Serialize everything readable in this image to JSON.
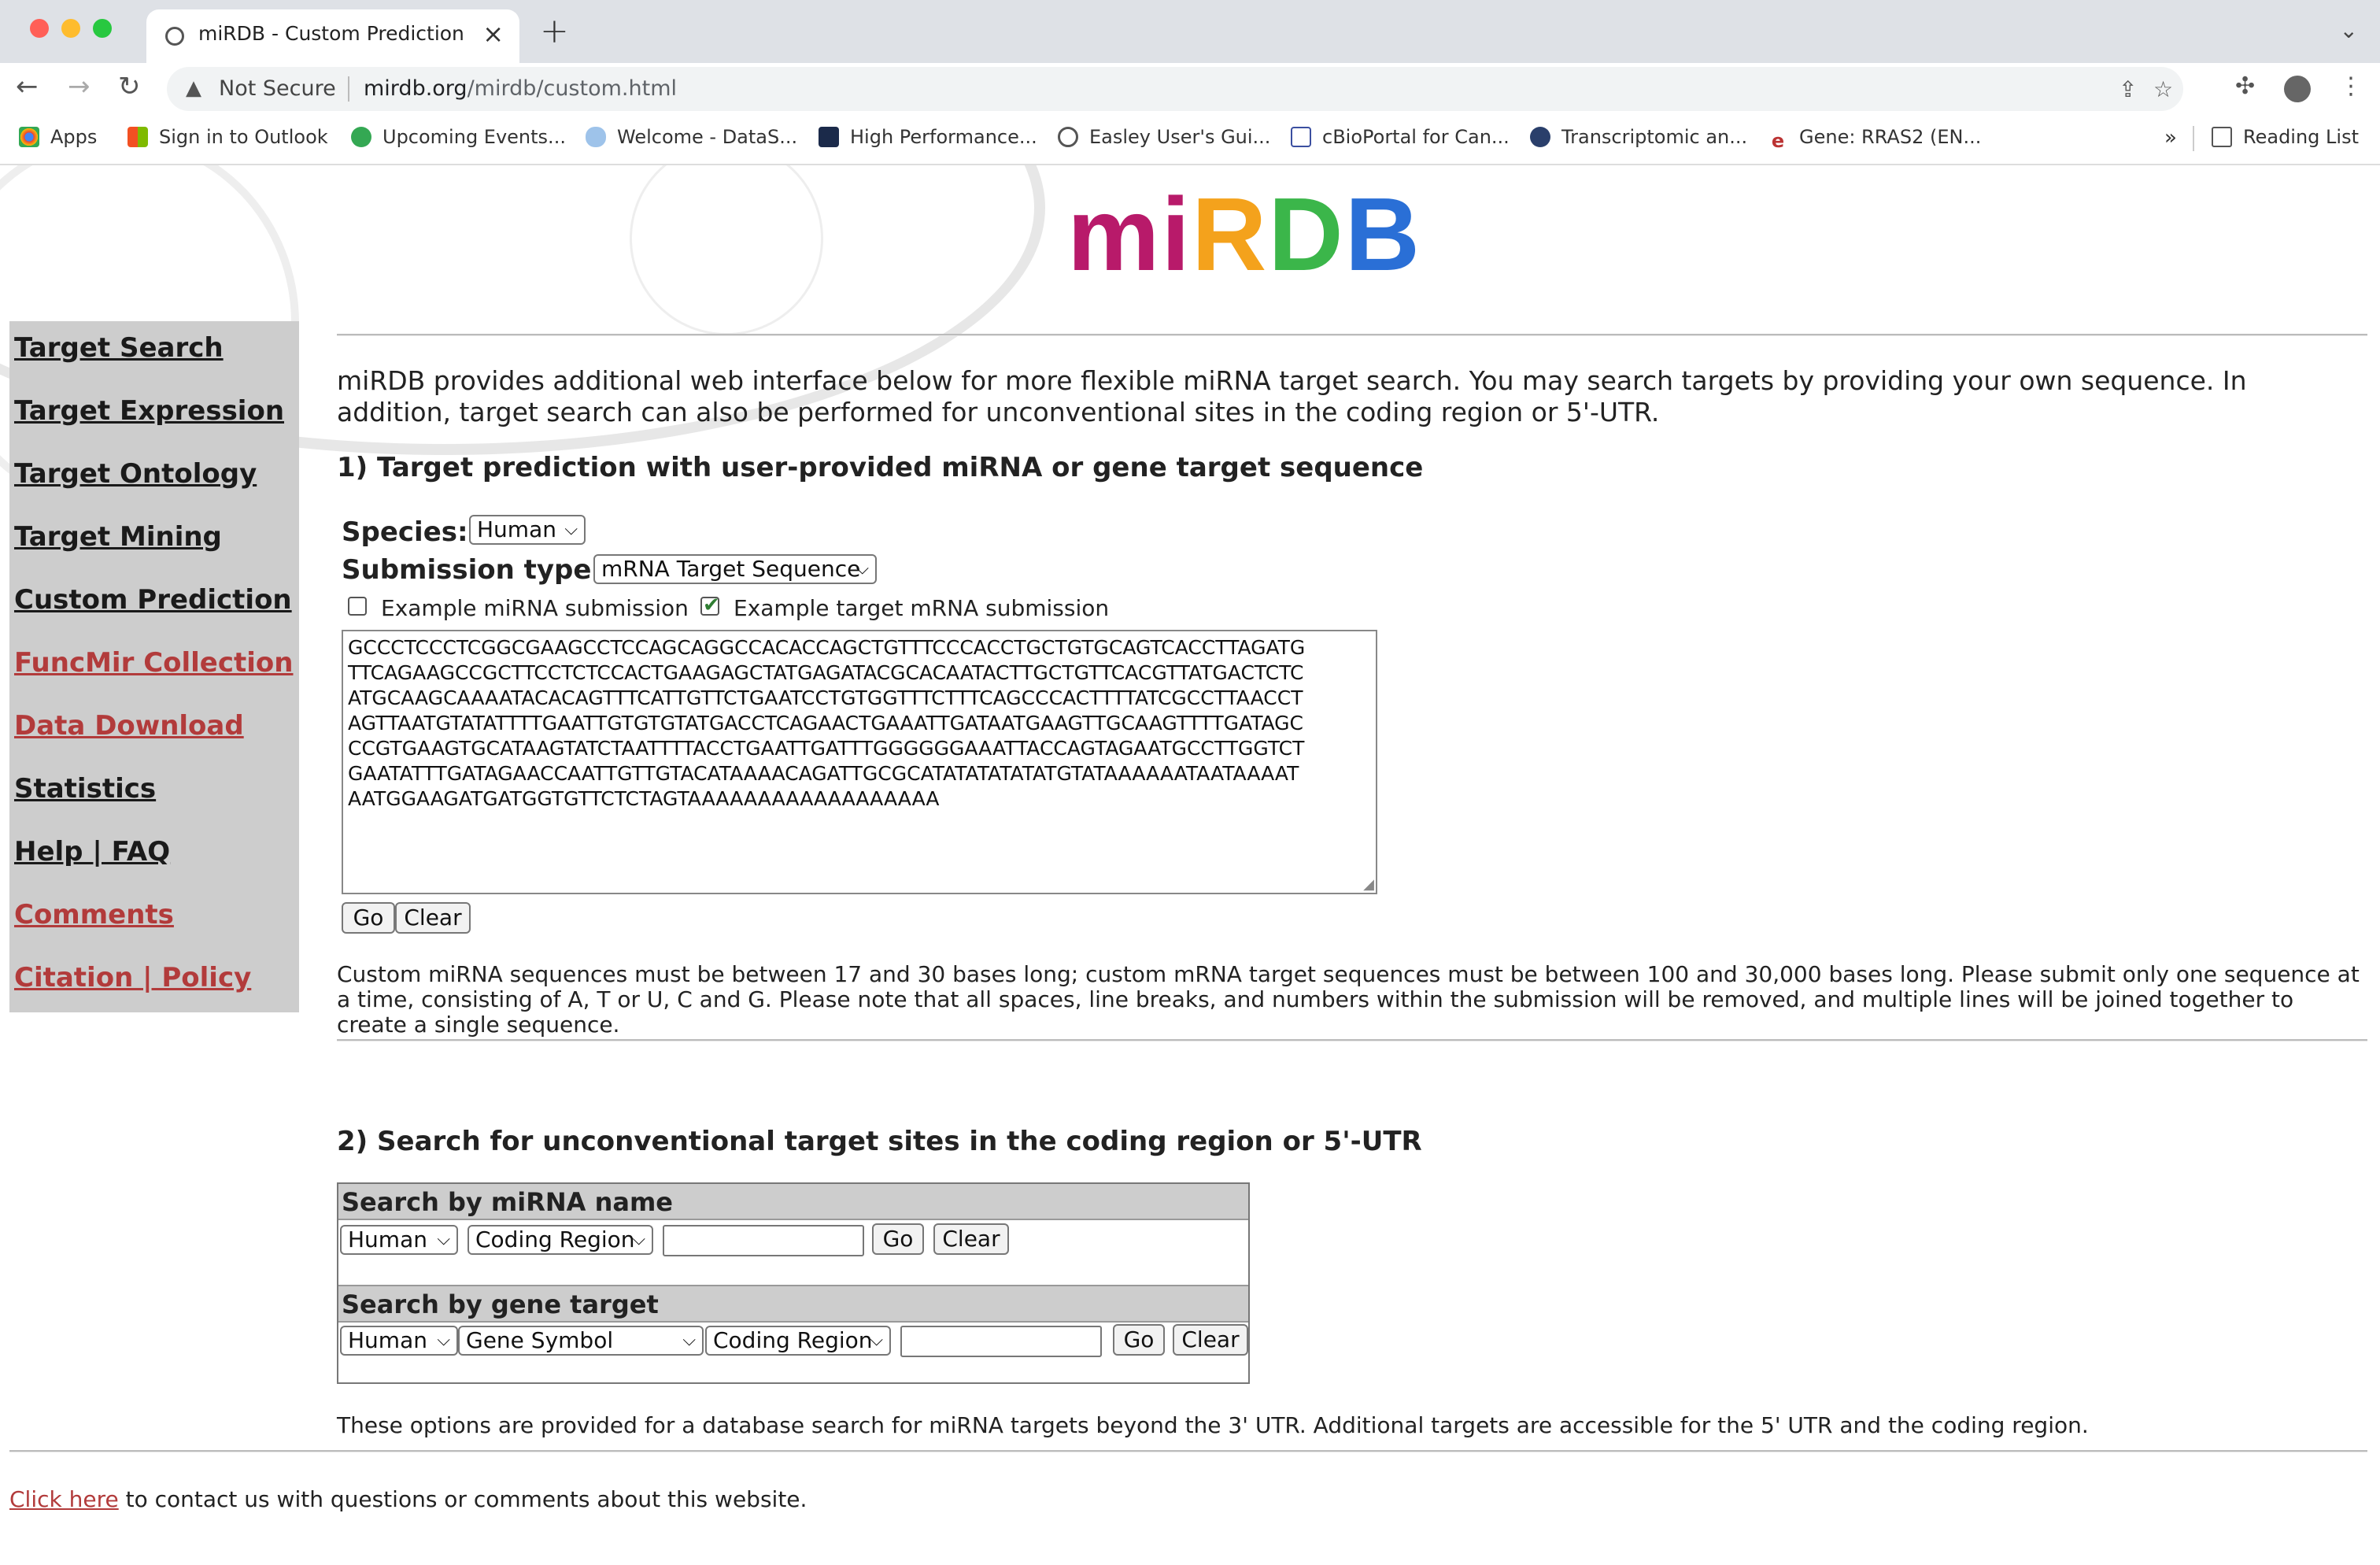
{
  "browser": {
    "tab_title": "miRDB - Custom Prediction",
    "security_label": "Not Secure",
    "url_domain": "mirdb.org",
    "url_path": "/mirdb/custom.html",
    "bookmarks": [
      {
        "label": "Apps",
        "icon": "apps-grid-icon"
      },
      {
        "label": "Sign in to Outlook",
        "icon": "microsoft-icon"
      },
      {
        "label": "Upcoming Events...",
        "icon": "check-leaf-icon"
      },
      {
        "label": "Welcome - DataS...",
        "icon": "cloud-icon"
      },
      {
        "label": "High Performance...",
        "icon": "tiger-icon"
      },
      {
        "label": "Easley User's Gui...",
        "icon": "globe-icon"
      },
      {
        "label": "cBioPortal for Can...",
        "icon": "cbioportal-icon"
      },
      {
        "label": "Transcriptomic an...",
        "icon": "circle-logo-icon"
      },
      {
        "label": "Gene: RRAS2 (EN...",
        "icon": "ensembl-icon"
      }
    ],
    "reading_list": "Reading List",
    "overflow": "»"
  },
  "logo": {
    "letters": [
      "mi",
      "R",
      "D",
      "B"
    ],
    "text": "miRDB"
  },
  "sidebar": {
    "items": [
      {
        "label": "Target Search"
      },
      {
        "label": "Target Expression"
      },
      {
        "label": "Target Ontology"
      },
      {
        "label": "Target Mining"
      },
      {
        "label": "Custom Prediction"
      },
      {
        "label": "FuncMir Collection"
      },
      {
        "label": "Data Download"
      },
      {
        "label": "Statistics"
      },
      {
        "label": "Help | FAQ"
      },
      {
        "label": "Comments"
      },
      {
        "label": "Citation | Policy"
      }
    ]
  },
  "intro": "miRDB provides additional web interface below for more flexible miRNA target search. You may search targets by providing your own sequence. In addition, target search can also be performed for unconventional sites in the coding region or 5'-UTR.",
  "section1": {
    "title": "1) Target prediction with user-provided miRNA or gene target sequence",
    "species_label": "Species:",
    "species_value": "Human",
    "submission_label": "Submission type:",
    "submission_value": "mRNA Target Sequence",
    "example_mirna": {
      "label": "Example miRNA submission",
      "checked": false
    },
    "example_target": {
      "label": "Example target mRNA submission",
      "checked": true
    },
    "sequence_lines": [
      "GCCCTCCCTCGGCGAAGCCTCCAGCAGGCCACACCAGCTGTTTCCCACCTGCTGTGCAGTCACCTTAGATG",
      "TTCAGAAGCCGCTTCCTCTCCACTGAAGAGCTATGAGATACGCACAATACTTGCTGTTCACGTTATGACTCTC",
      "ATGCAAGCAAAATACACAGTTTCATTGTTCTGAATCCTGTGGTTTCTTTCAGCCCACTTTTATCGCCTTAACCT",
      "AGTTAATGTATATTTTGAATTGTGTGTATGACCTCAGAACTGAAATTGATAATGAAGTTGCAAGTTTTGATAGC",
      "CCGTGAAGTGCATAAGTATCTAATTTTACCTGAATTGATTTGGGGGGAAATTACCAGTAGAATGCCTTGGTCT",
      "GAATATTTGATAGAACCAATTGTTGTACATAAAACAGATTGCGCATATATATATATGTATAAAAAATAATAAAAT",
      "AATGGAAGATGATGGTGTTCTCTAGTAAAAAAAAAAAAAAAAAA"
    ],
    "go_label": "Go",
    "clear_label": "Clear",
    "note": "Custom miRNA sequences must be between 17 and 30 bases long; custom mRNA target sequences must be between 100 and 30,000 bases long.  Please submit only one sequence at a time, consisting of A, T or U, C and G.  Please note that all spaces, line breaks, and numbers within the submission will be removed, and multiple lines will be joined together to create a single sequence."
  },
  "section2": {
    "title": "2) Search for unconventional target sites in the coding region or 5'-UTR",
    "by_mirna": {
      "header": "Search by miRNA name",
      "species": "Human",
      "region": "Coding Region",
      "input_value": "",
      "go_label": "Go",
      "clear_label": "Clear"
    },
    "by_gene": {
      "header": "Search by gene target",
      "species": "Human",
      "id_type": "Gene Symbol",
      "region": "Coding Region",
      "input_value": "",
      "go_label": "Go",
      "clear_label": "Clear"
    },
    "footer_note": "These options are provided for a database search for miRNA targets beyond the 3' UTR. Additional targets are accessible for the 5' UTR and the coding region."
  },
  "contact": {
    "link": "Click here",
    "text": " to contact us with questions or comments about this website."
  },
  "colors": {
    "sidebar_bg": "#cdcdcd",
    "link_red": "#b23b3b",
    "table_header_bg": "#cdcdcd"
  }
}
